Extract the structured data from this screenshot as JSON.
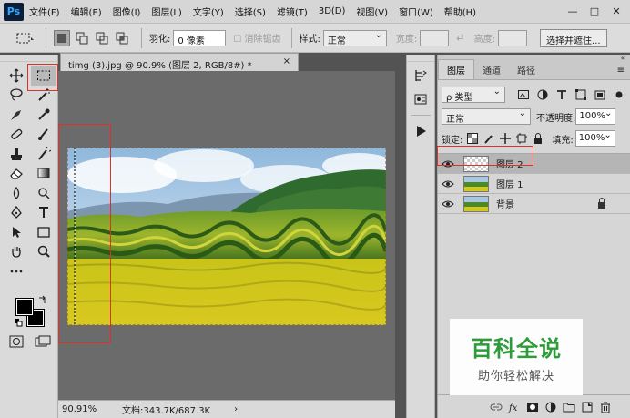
{
  "app": {
    "logo": "Ps",
    "menu": [
      "文件(F)",
      "编辑(E)",
      "图像(I)",
      "图层(L)",
      "文字(Y)",
      "选择(S)",
      "滤镜(T)",
      "3D(D)",
      "视图(V)",
      "窗口(W)",
      "帮助(H)"
    ],
    "window_controls": [
      "—",
      "□",
      "✕"
    ]
  },
  "options": {
    "feather_label": "羽化:",
    "feather_value": "0 像素",
    "antialias_label": "消除锯齿",
    "style_label": "样式:",
    "style_value": "正常",
    "width_label": "宽度:",
    "height_label": "高度:",
    "select_mask_button": "选择并遮住..."
  },
  "document": {
    "tab_title": "timg (3).jpg @ 90.9% (图层 2, RGB/8#) *",
    "close": "×",
    "zoom": "90.91%",
    "doc_info": "文档:343.7K/687.3K",
    "status_arrow": "›"
  },
  "layers_panel": {
    "collapse": "«",
    "tabs": [
      "图层",
      "通道",
      "路径"
    ],
    "menu": "≡",
    "kind_filter": "ρ 类型",
    "blend_mode": "正常",
    "opacity_label": "不透明度:",
    "opacity_value": "100%",
    "lock_label": "锁定:",
    "fill_label": "填充:",
    "fill_value": "100%",
    "layers": [
      {
        "name": "图层 2",
        "selected": true,
        "locked": false
      },
      {
        "name": "图层 1",
        "selected": false,
        "locked": false
      },
      {
        "name": "背景",
        "selected": false,
        "locked": true
      }
    ]
  },
  "watermark": {
    "title": "百科全说",
    "subtitle": "助你轻松解决"
  },
  "colors": {
    "highlight": "#e0302a",
    "foreground": "#000000",
    "background": "#000000"
  }
}
